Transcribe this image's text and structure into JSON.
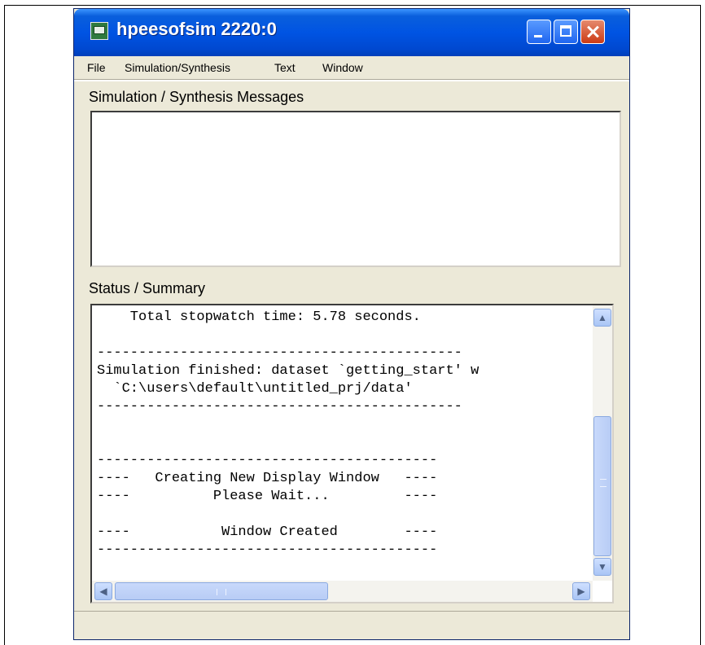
{
  "window": {
    "title": "hpeesofsim 2220:0",
    "icons": {
      "app": "app-window-icon",
      "minimize": "minimize-icon",
      "maximize": "maximize-icon",
      "close": "close-icon"
    }
  },
  "menu": {
    "items": [
      {
        "label": "File"
      },
      {
        "label": "Simulation/Synthesis"
      },
      {
        "label": "Text"
      },
      {
        "label": "Window"
      }
    ]
  },
  "sections": {
    "messages_label": "Simulation / Synthesis Messages",
    "status_label": "Status / Summary"
  },
  "status_log": {
    "lines": [
      "    Total stopwatch time: 5.78 seconds.",
      "",
      "--------------------------------------------",
      "Simulation finished: dataset `getting_start' w",
      "  `C:\\users\\default\\untitled_prj/data'",
      "--------------------------------------------",
      "",
      "",
      "-----------------------------------------",
      "----   Creating New Display Window   ----",
      "----          Please Wait...         ----",
      "",
      "----           Window Created        ----",
      "-----------------------------------------"
    ]
  },
  "colors": {
    "titlebar": "#0054e3",
    "window_bg": "#ece9d8",
    "close_button": "#d8492a",
    "scrollbar_thumb": "#c1d3fb"
  }
}
